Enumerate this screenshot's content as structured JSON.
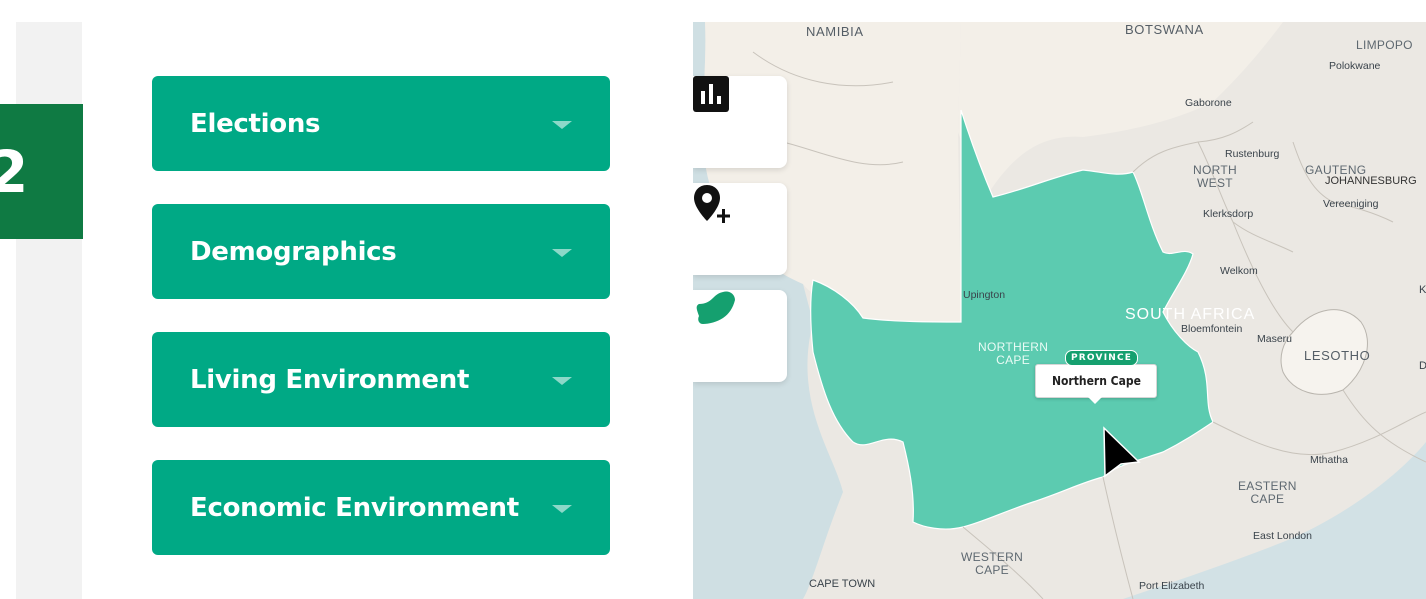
{
  "step": {
    "number": "2"
  },
  "categories": [
    {
      "label": "Elections"
    },
    {
      "label": "Demographics"
    },
    {
      "label": "Living Environment"
    },
    {
      "label": "Economic Environment"
    }
  ],
  "map": {
    "countries": [
      "NAMIBIA",
      "BOTSWANA",
      "LESOTHO"
    ],
    "country_main": "SOUTH AFRICA",
    "regions": {
      "limpopo": "LIMPOPO",
      "gauteng": "GAUTENG",
      "north_west": [
        "NORTH",
        "WEST"
      ],
      "northern_cape": [
        "NORTHERN",
        "CAPE"
      ],
      "eastern_cape": [
        "EASTERN",
        "CAPE"
      ],
      "western_cape": [
        "WESTERN",
        "CAPE"
      ]
    },
    "cities": {
      "polokwane": "Polokwane",
      "gaborone": "Gaborone",
      "rustenburg": "Rustenburg",
      "johannesburg": "JOHANNESBURG",
      "vereeniging": "Vereeniging",
      "klerksdorp": "Klerksdorp",
      "welkom": "Welkom",
      "upington": "Upington",
      "bloemfontein": "Bloemfontein",
      "maseru": "Maseru",
      "mthatha": "Mthatha",
      "east_london": "East London",
      "port_elizabeth": "Port Elizabeth",
      "cape_town": "CAPE TOWN"
    },
    "edge_letters": {
      "k": "K",
      "d": "D"
    },
    "tooltip": {
      "badge": "PROVINCE",
      "title": "Northern Cape"
    },
    "selected_province_color": "#5ccbb0",
    "tools": [
      "bar-chart-icon",
      "add-location-icon",
      "south-africa-icon"
    ]
  },
  "colors": {
    "accent": "#00a985",
    "badge": "#0f7a43"
  }
}
